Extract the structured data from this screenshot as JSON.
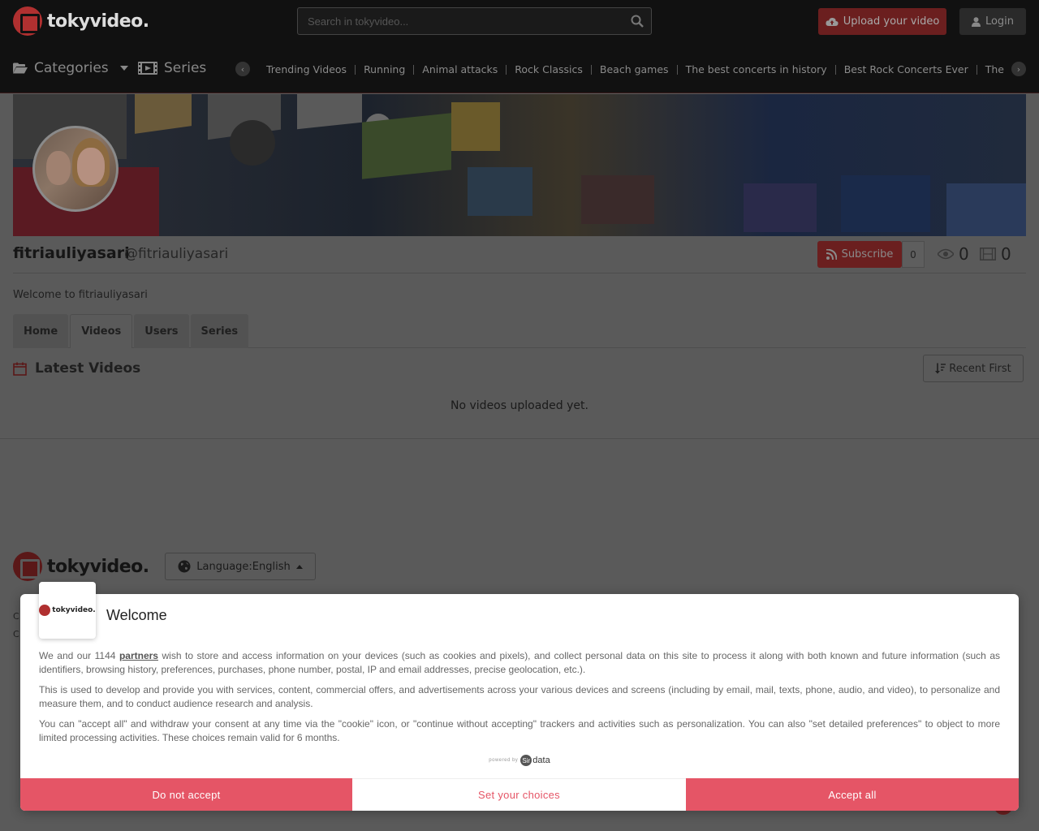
{
  "header": {
    "logo_text": "tokyvideo.",
    "search_placeholder": "Search in tokyvideo...",
    "upload_label": "Upload your video",
    "login_label": "Login"
  },
  "nav": {
    "categories_label": "Categories",
    "series_label": "Series",
    "links": [
      "Trending Videos",
      "Running",
      "Animal attacks",
      "Rock Classics",
      "Beach games",
      "The best concerts in history",
      "Best Rock Concerts Ever",
      "The b"
    ]
  },
  "profile": {
    "username": "fitriauliyasari",
    "handle": "@fitriauliyasari",
    "subscribe_label": "Subscribe",
    "subscribe_count": "0",
    "views_count": "0",
    "videos_count": "0",
    "welcome": "Welcome to fitriauliyasari"
  },
  "tabs": [
    "Home",
    "Videos",
    "Users",
    "Series"
  ],
  "content": {
    "section_title": "Latest Videos",
    "sort_label": "Recent First",
    "empty_text": "No videos uploaded yet."
  },
  "footer": {
    "logo_text": "tokyvideo.",
    "language_label": "Language:English",
    "line1": "C",
    "line2": "C"
  },
  "cookie": {
    "logo_text": "tokyvideo.",
    "title": "Welcome",
    "p1_before": "We and our 1144 ",
    "p1_link": "partners",
    "p1_after": " wish to store and access information on your devices (such as cookies and pixels), and collect personal data on this site to process it along with both known and future information (such as identifiers, browsing history, preferences, purchases, phone number, postal, IP and email addresses, precise geolocation, etc.).",
    "p2": "This is used to develop and provide you with services, content, commercial offers, and advertisements across your various devices and screens (including by email, mail, texts, phone, audio, and video), to personalize and measure them, and to conduct audience research and analysis.",
    "p3": "You can \"accept all\" and withdraw your consent at any time via the \"cookie\" icon, or \"continue without accepting\" trackers and activities such as personalization. You can also \"set detailed preferences\" to object to more limited processing activities. These choices remain valid for 6 months.",
    "powered_by": "powered by",
    "powered_brand": "data",
    "powered_brand_mark": "Sir",
    "btn_reject": "Do not accept",
    "btn_choices": "Set your choices",
    "btn_accept": "Accept all"
  },
  "colors": {
    "accent_red": "#e55566",
    "brand_red": "#b03030"
  }
}
